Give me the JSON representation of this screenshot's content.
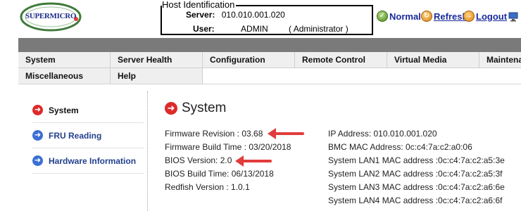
{
  "logo": {
    "text": "SUPERMICRO",
    "icon": "supermicro-logo"
  },
  "host": {
    "legend": "Host Identification",
    "server_label": "Server:",
    "server_value": "010.010.001.020",
    "user_label": "User:",
    "user_value": "ADMIN",
    "user_role": "( Administrator )"
  },
  "status_links": {
    "normal": "Normal",
    "refresh": "Refresh",
    "logout": "Logout"
  },
  "menu": {
    "row1": [
      "System",
      "Server Health",
      "Configuration",
      "Remote Control",
      "Virtual Media",
      "Maintena"
    ],
    "row2": [
      "Miscellaneous",
      "Help"
    ]
  },
  "sidebar": {
    "items": [
      {
        "label": "System",
        "icon": "arrow-right-red-icon",
        "active": true
      },
      {
        "label": "FRU Reading",
        "icon": "arrow-right-blue-icon",
        "active": false
      },
      {
        "label": "Hardware Information",
        "icon": "arrow-right-blue-icon",
        "active": false
      }
    ]
  },
  "main": {
    "title": "System",
    "left": [
      "Firmware Revision :  03.68",
      "Firmware Build Time :  03/20/2018",
      "BIOS Version: 2.0",
      "BIOS Build Time: 06/13/2018",
      "Redfish Version :  1.0.1"
    ],
    "right": [
      "IP Address:  010.010.001.020",
      "BMC MAC Address:  0c:c4:7a:c2:a0:06",
      "System LAN1 MAC address :0c:c4:7a:c2:a5:3e",
      "System LAN2 MAC address :0c:c4:7a:c2:a5:3f",
      "System LAN3 MAC address :0c:c4:7a:c2:a6:6e",
      "System LAN4 MAC address :0c:c4:7a:c2:a6:6f"
    ]
  },
  "colors": {
    "accent_red": "#e23b3b",
    "menu_bg": "#efefef",
    "band": "#7a7a7a",
    "link_blue": "#23408e"
  }
}
